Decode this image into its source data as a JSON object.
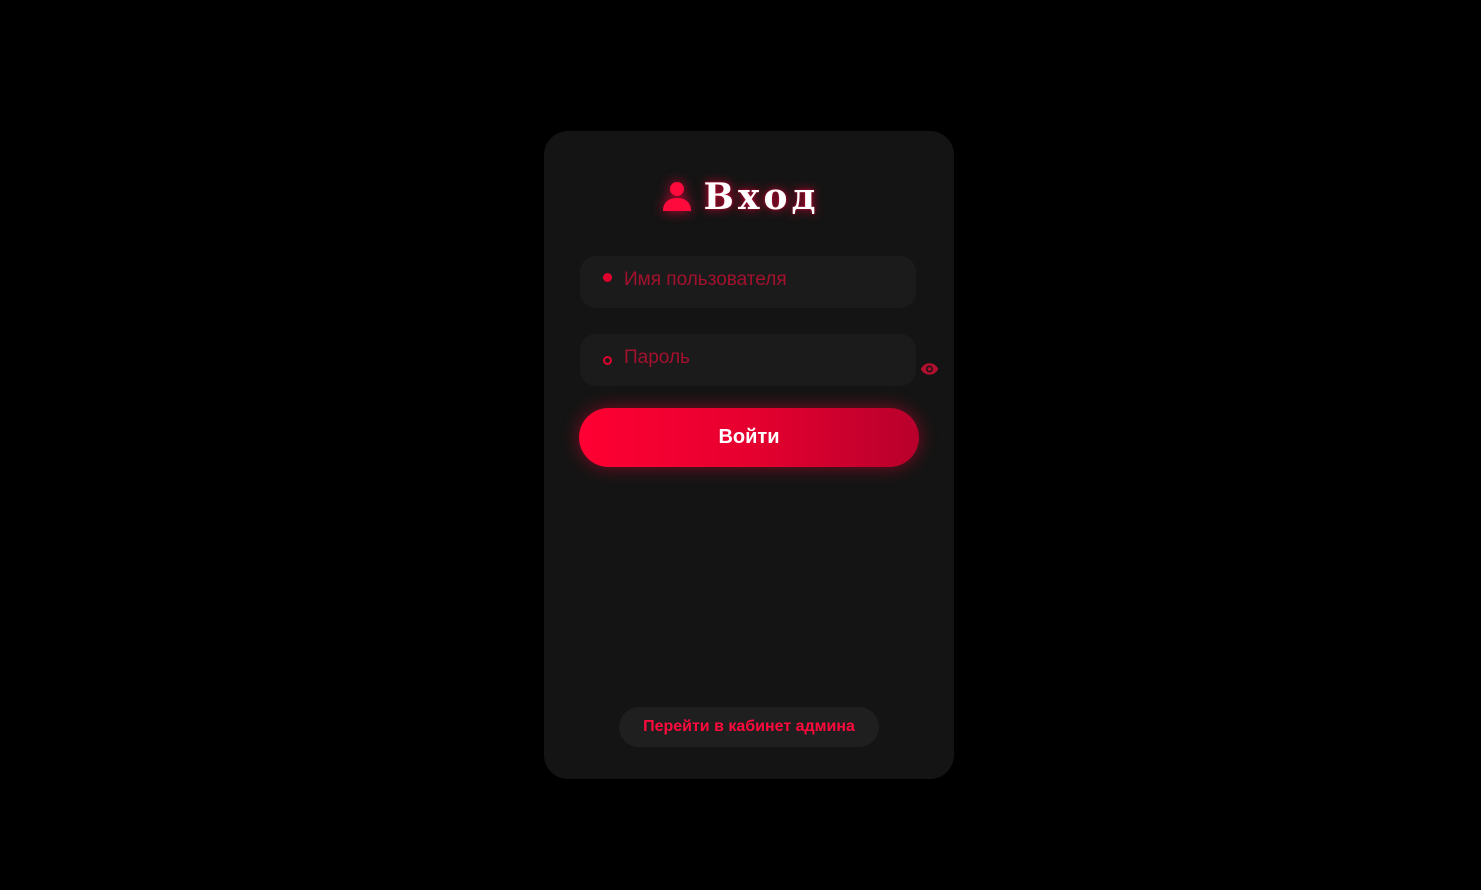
{
  "login_card": {
    "title": "Вход",
    "title_icon": "user-icon",
    "username": {
      "icon": "filled-dot-icon",
      "value": "",
      "placeholder": "Имя пользователя"
    },
    "password": {
      "icon": "ring-icon",
      "value": "",
      "placeholder": "Пароль",
      "toggle_icon": "eye-icon"
    },
    "submit_label": "Войти",
    "admin_link_label": "Перейти в кабинет админа"
  },
  "colors": {
    "background": "#000000",
    "card": "#141414",
    "accent": "#ff0033",
    "accent_dark": "#b8002c",
    "placeholder": "#a3112e",
    "text": "#ffffff"
  }
}
